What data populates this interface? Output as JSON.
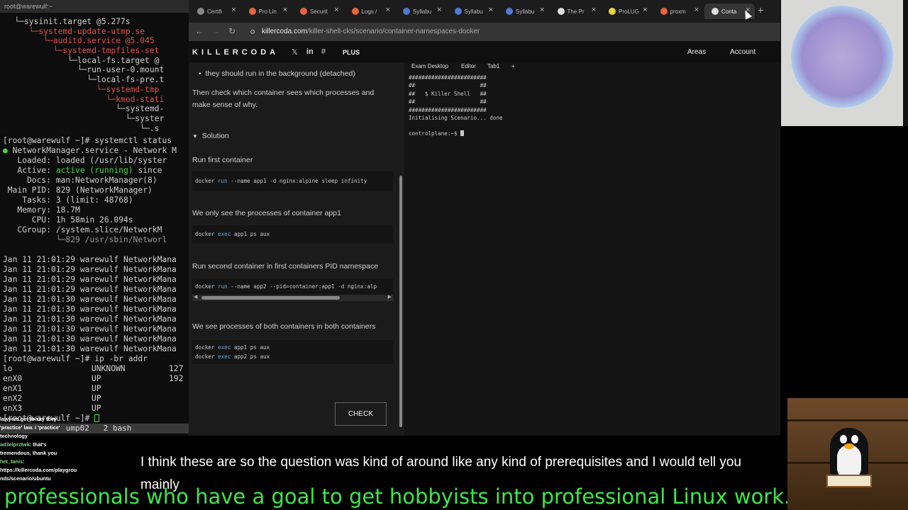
{
  "terminal": {
    "title": "root@warewulf:~",
    "tree": [
      "   └─sysinit.target @5.277s",
      "      └─systemd-update-utmp.se",
      "         └─auditd.service @5.045",
      "           └─systemd-tmpfiles-set",
      "              └─local-fs.target @",
      "                └─run-user-0.mount",
      "                  └─local-fs-pre.t",
      "                    └─systemd-tmp",
      "                      └─kmod-stati",
      "                        └─systemd-",
      "                          └─syster",
      "                             └─.s"
    ],
    "tree_colors": [
      "",
      "red",
      "red",
      "red",
      "",
      "",
      "",
      "red",
      "red",
      "",
      "",
      ""
    ],
    "status_cmd": "[root@warewulf ~]# systemctl status",
    "service_name": "NetworkManager.service - Network M",
    "loaded": "   Loaded: loaded (/usr/lib/syster",
    "active_label": "   Active: ",
    "active_value": "active (running)",
    "active_rest": " since",
    "docs": "     Docs: man:NetworkManager(8)",
    "main_pid": " Main PID: 829 (NetworkManager)",
    "tasks": "    Tasks: 3 (limit: 48768)",
    "memory": "   Memory: 18.7M",
    "cpu": "      CPU: 1h 58min 26.094s",
    "cgroup": "   CGroup: /system.slice/NetworkM",
    "cgroup_child": "           └─829 /usr/sbin/Networl",
    "log_lines": [
      "Jan 11 21:01:29 warewulf NetworkMana",
      "Jan 11 21:01:29 warewulf NetworkMana",
      "Jan 11 21:01:29 warewulf NetworkMana",
      "Jan 11 21:01:29 warewulf NetworkMana",
      "Jan 11 21:01:30 warewulf NetworkMana",
      "Jan 11 21:01:30 warewulf NetworkMana",
      "Jan 11 21:01:30 warewulf NetworkMana",
      "Jan 11 21:01:30 warewulf NetworkMana",
      "Jan 11 21:01:30 warewulf NetworkMana",
      "Jan 11 21:01:30 warewulf NetworkMana"
    ],
    "ip_cmd": "[root@warewulf ~]# ip -br addr",
    "ifaces": [
      {
        "name": "lo",
        "state": "UNKNOWN",
        "addr": "127"
      },
      {
        "name": "enX0",
        "state": "UP",
        "addr": "192"
      },
      {
        "name": "enX1",
        "state": "UP",
        "addr": ""
      },
      {
        "name": "enX2",
        "state": "UP",
        "addr": ""
      },
      {
        "name": "enX3",
        "state": "UP",
        "addr": ""
      }
    ],
    "last_prompt": "[root@warewulf ~]# ",
    "status_bar": "              ump02   2 bash"
  },
  "browser": {
    "tabs": [
      {
        "label": "Certifi",
        "color": "#888888"
      },
      {
        "label": "Pro Lin",
        "color": "#e8643c"
      },
      {
        "label": "Securit",
        "color": "#e8643c"
      },
      {
        "label": "Logs /",
        "color": "#e8643c"
      },
      {
        "label": "Syllabu",
        "color": "#4f79d8"
      },
      {
        "label": "Syllabu",
        "color": "#4f79d8"
      },
      {
        "label": "Syllabu",
        "color": "#4f79d8"
      },
      {
        "label": "The Pr",
        "color": "#dddddd"
      },
      {
        "label": "ProLUG",
        "color": "#e8d43c"
      },
      {
        "label": "proxm",
        "color": "#e8643c"
      },
      {
        "label": "Conta",
        "color": "#dddddd"
      }
    ],
    "url_host": "killercoda.com",
    "url_path": "/killer-shell-cks/scenario/container-namespaces-docker"
  },
  "site": {
    "logo": "KILLERCODA",
    "plus": "PLUS",
    "areas": "Areas",
    "account": "Account"
  },
  "scenario": {
    "bullet": "they should run in the background (detached)",
    "para": "Then check which container sees which processes and make sense of why.",
    "solution": "Solution",
    "step1": "Run first container",
    "code1_cmd": "docker ",
    "code1_kw": "run",
    "code1_rest": " --name app1 -d nginx:alpine sleep infinity",
    "step2": "We only see the processes of container app1",
    "code2_cmd": "docker ",
    "code2_kw": "exec",
    "code2_rest": " app1 ps aux",
    "step3": "Run second container in first containers PID namespace",
    "code3_cmd": "docker ",
    "code3_kw": "run",
    "code3_rest": " --name app2 --pid=container:app1 -d nginx:alp",
    "step4": "We see processes of both containers in both containers",
    "code4a_cmd": "docker ",
    "code4a_kw": "exec",
    "code4a_rest": " app1 ps aux",
    "code4b_cmd": "docker ",
    "code4b_kw": "exec",
    "code4b_rest": " app2 ps aux",
    "check": "CHECK"
  },
  "kterm": {
    "tabs": [
      "Exam Desktop",
      "Editor",
      "Tab1",
      "+"
    ],
    "output": "########################\n##                    ##\n##   $ Killer Shell   ##\n##                    ##\n########################\nInitialising Scenario... done",
    "prompt": "controlplane:~$ "
  },
  "chat": [
    {
      "name": "",
      "text": "lawyers get to say they"
    },
    {
      "name": "",
      "text": "'practice' law. I 'practice'"
    },
    {
      "name": "",
      "text": "technology"
    },
    {
      "name": "ad3elprztwk",
      "text": ": that's"
    },
    {
      "name": "",
      "text": "tremendous, thank you"
    },
    {
      "name": "het_tanis",
      "text": ":"
    },
    {
      "name": "",
      "text": "https://killercoda.com/playgrou"
    },
    {
      "name": "",
      "text": "nds/scenario/ubuntu"
    }
  ],
  "caption": "I think these are so the question was kind of around like any kind of prerequisites and I would tell you mainly",
  "ticker": "professionals who have a goal to get hobbyists into professional Linux work. !clip to"
}
